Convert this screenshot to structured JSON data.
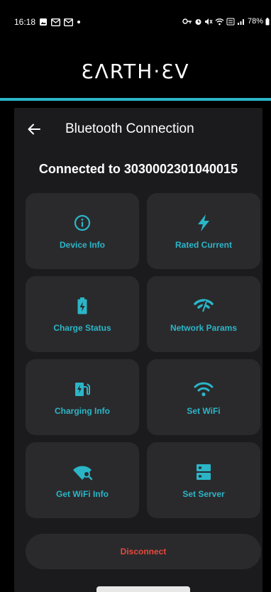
{
  "status_bar": {
    "time": "16:18",
    "battery": "78%"
  },
  "brand": {
    "name": "ƐΛRTH·ƐV"
  },
  "header": {
    "title": "Bluetooth Connection"
  },
  "connection": {
    "text": "Connected to 3030002301040015"
  },
  "tiles": [
    {
      "label": "Device Info",
      "icon": "info-icon"
    },
    {
      "label": "Rated Current",
      "icon": "bolt-icon"
    },
    {
      "label": "Charge Status",
      "icon": "battery-charging-icon"
    },
    {
      "label": "Network Params",
      "icon": "network-signal-icon"
    },
    {
      "label": "Charging Info",
      "icon": "ev-station-icon"
    },
    {
      "label": "Set WiFi",
      "icon": "wifi-icon"
    },
    {
      "label": "Get WiFi Info",
      "icon": "wifi-search-icon"
    },
    {
      "label": "Set Server",
      "icon": "server-icon"
    }
  ],
  "actions": {
    "disconnect_label": "Disconnect"
  },
  "colors": {
    "accent": "#2bb6c8",
    "danger": "#e64a3c",
    "card": "#2a2a2c",
    "panel": "#1b1b1d"
  }
}
